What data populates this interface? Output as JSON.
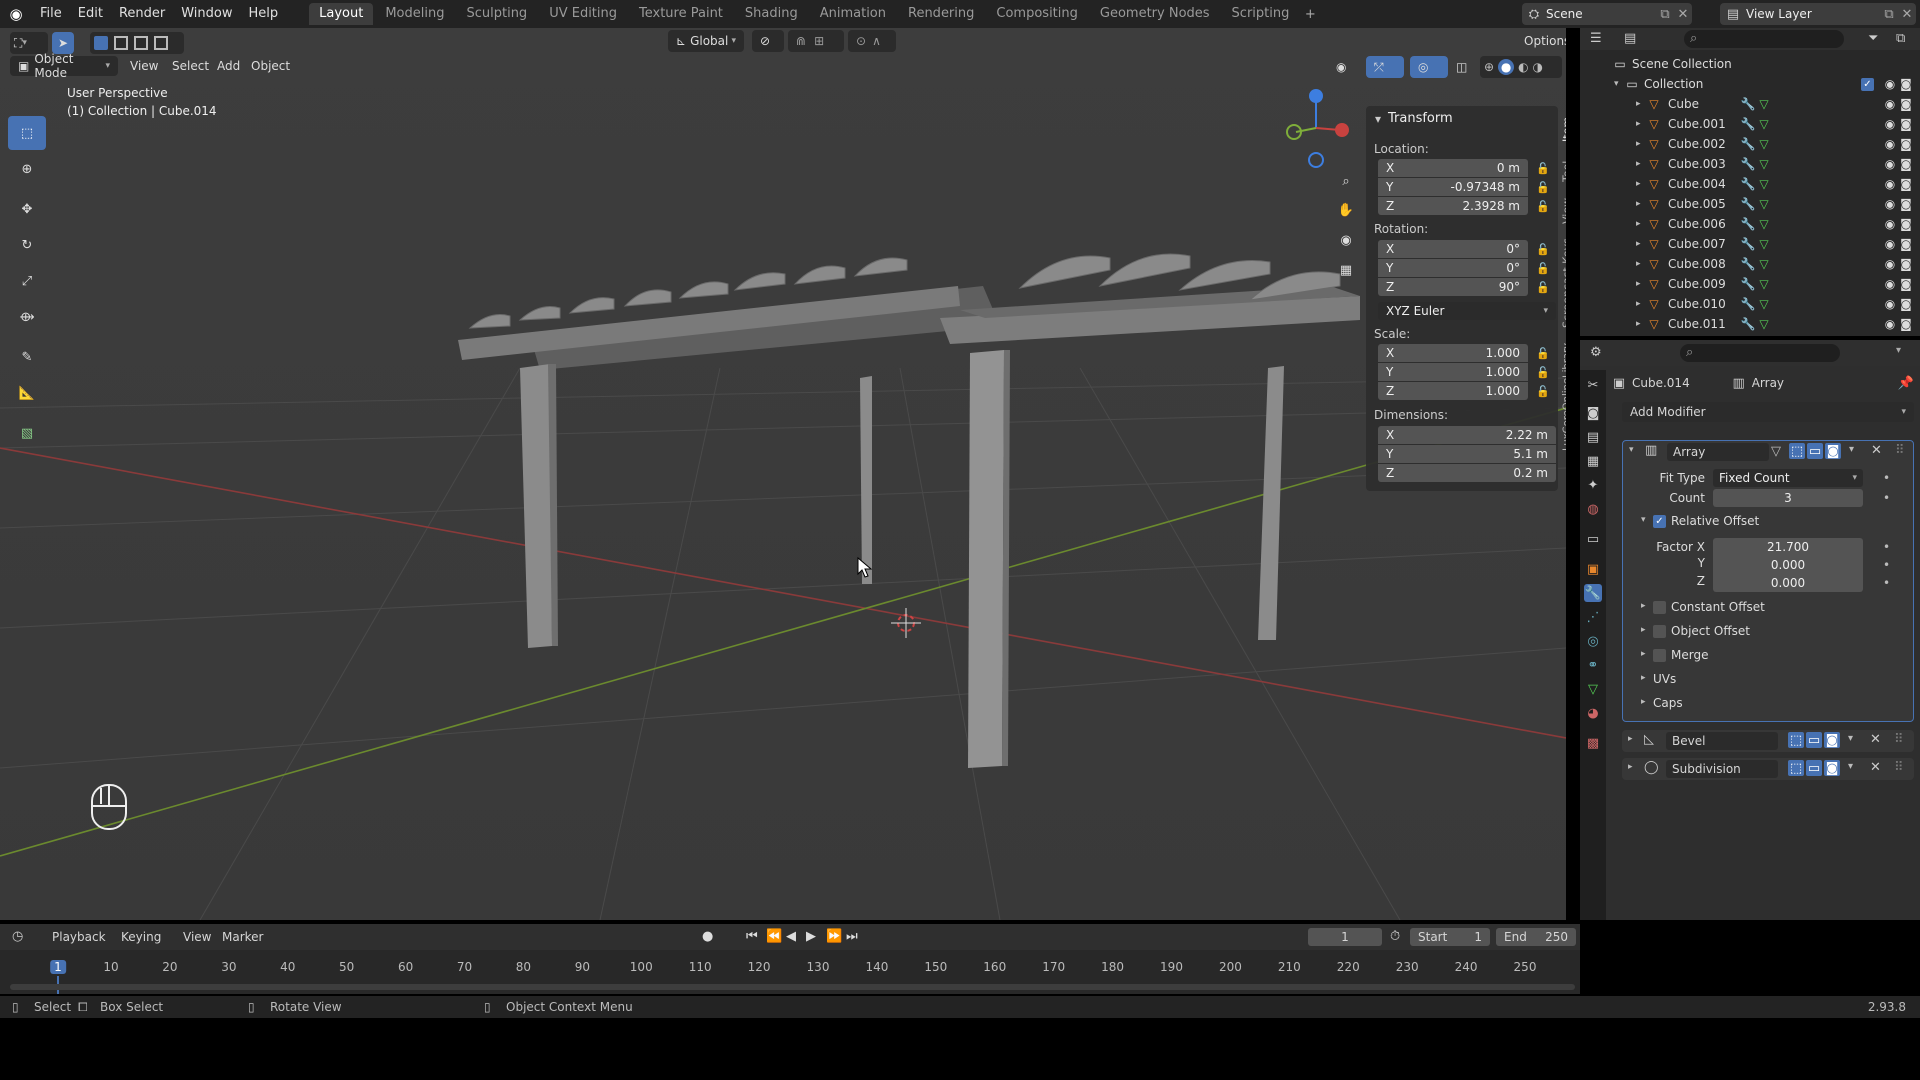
{
  "topbar": {
    "menus": [
      "File",
      "Edit",
      "Render",
      "Window",
      "Help"
    ],
    "workspaces": [
      "Layout",
      "Modeling",
      "Sculpting",
      "UV Editing",
      "Texture Paint",
      "Shading",
      "Animation",
      "Rendering",
      "Compositing",
      "Geometry Nodes",
      "Scripting"
    ],
    "active_workspace": "Layout",
    "scene": "Scene",
    "view_layer": "View Layer"
  },
  "viewport": {
    "mode": "Object Mode",
    "menus": [
      "View",
      "Select",
      "Add",
      "Object"
    ],
    "orientation": "Global",
    "options": "Options",
    "overlay_title": "User Perspective",
    "overlay_subtitle": "(1) Collection | Cube.014"
  },
  "npanel": {
    "section": "Transform",
    "location_label": "Location:",
    "location": [
      {
        "axis": "X",
        "value": "0 m"
      },
      {
        "axis": "Y",
        "value": "-0.97348 m"
      },
      {
        "axis": "Z",
        "value": "2.3928 m"
      }
    ],
    "rotation_label": "Rotation:",
    "rotation": [
      {
        "axis": "X",
        "value": "0°"
      },
      {
        "axis": "Y",
        "value": "0°"
      },
      {
        "axis": "Z",
        "value": "90°"
      }
    ],
    "rotation_mode": "XYZ Euler",
    "scale_label": "Scale:",
    "scale": [
      {
        "axis": "X",
        "value": "1.000"
      },
      {
        "axis": "Y",
        "value": "1.000"
      },
      {
        "axis": "Z",
        "value": "1.000"
      }
    ],
    "dimensions_label": "Dimensions:",
    "dimensions": [
      {
        "axis": "X",
        "value": "2.22 m"
      },
      {
        "axis": "Y",
        "value": "5.1 m"
      },
      {
        "axis": "Z",
        "value": "0.2 m"
      }
    ],
    "tabs": [
      "Item",
      "Tool",
      "View",
      "Screencast Keys",
      "LuxCoreOnlineLibrary"
    ]
  },
  "outliner": {
    "root": "Scene Collection",
    "collection": "Collection",
    "objects": [
      "Cube",
      "Cube.001",
      "Cube.002",
      "Cube.003",
      "Cube.004",
      "Cube.005",
      "Cube.006",
      "Cube.007",
      "Cube.008",
      "Cube.009",
      "Cube.010",
      "Cube.011"
    ]
  },
  "properties": {
    "object_name": "Cube.014",
    "modifier_context": "Array",
    "add_modifier": "Add Modifier",
    "array": {
      "name": "Array",
      "fit_type_label": "Fit Type",
      "fit_type": "Fixed Count",
      "count_label": "Count",
      "count": "3",
      "relative_offset": "Relative Offset",
      "factor_x_label": "Factor X",
      "factor_x": "21.700",
      "y_label": "Y",
      "factor_y": "0.000",
      "z_label": "Z",
      "factor_z": "0.000",
      "subpanels": [
        "Constant Offset",
        "Object Offset",
        "Merge",
        "UVs",
        "Caps"
      ]
    },
    "bevel": "Bevel",
    "subdivision": "Subdivision"
  },
  "timeline": {
    "menus": [
      "Playback",
      "Keying",
      "View",
      "Marker"
    ],
    "current_frame": "1",
    "start_label": "Start",
    "start": "1",
    "end_label": "End",
    "end": "250",
    "ticks": [
      "1",
      "10",
      "20",
      "30",
      "40",
      "50",
      "60",
      "70",
      "80",
      "90",
      "100",
      "110",
      "120",
      "130",
      "140",
      "150",
      "160",
      "170",
      "180",
      "190",
      "200",
      "210",
      "220",
      "230",
      "240",
      "250"
    ]
  },
  "statusbar": {
    "select": "Select",
    "box_select": "Box Select",
    "rotate_view": "Rotate View",
    "context_menu": "Object Context Menu",
    "version": "2.93.8"
  },
  "colors": {
    "accent": "#4772b3",
    "x_axis": "#c8423f",
    "y_axis": "#7fae3a",
    "z_axis": "#3d7ee0"
  }
}
